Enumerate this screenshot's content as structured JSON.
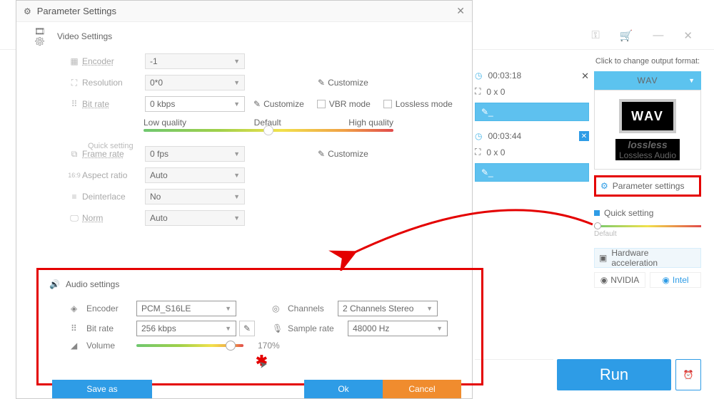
{
  "modal": {
    "title": "Parameter Settings",
    "video": {
      "header": "Video Settings",
      "encoder": {
        "label": "Encoder",
        "value": "-1"
      },
      "resolution": {
        "label": "Resolution",
        "value": "0*0",
        "customize": "Customize"
      },
      "bitrate": {
        "label": "Bit rate",
        "value": "0 kbps",
        "customize": "Customize",
        "vbr": "VBR mode",
        "lossless": "Lossless mode"
      },
      "quickset": {
        "label": "Quick setting",
        "low": "Low quality",
        "default": "Default",
        "high": "High quality"
      },
      "framerate": {
        "label": "Frame rate",
        "value": "0 fps",
        "customize": "Customize"
      },
      "aspect": {
        "label": "Aspect ratio",
        "value": "Auto"
      },
      "deinterlace": {
        "label": "Deinterlace",
        "value": "No"
      },
      "norm": {
        "label": "Norm",
        "value": "Auto"
      }
    },
    "audio": {
      "header": "Audio settings",
      "encoder": {
        "label": "Encoder",
        "value": "PCM_S16LE"
      },
      "channels": {
        "label": "Channels",
        "value": "2 Channels Stereo"
      },
      "bitrate": {
        "label": "Bit rate",
        "value": "256 kbps"
      },
      "samplerate": {
        "label": "Sample rate",
        "value": "48000 Hz"
      },
      "volume": {
        "label": "Volume",
        "value": "170%"
      }
    },
    "buttons": {
      "save": "Save as",
      "ok": "Ok",
      "cancel": "Cancel"
    }
  },
  "files": [
    {
      "duration": "00:03:18",
      "dim": "0 x 0"
    },
    {
      "duration": "00:03:44",
      "dim": "0 x 0"
    }
  ],
  "sidebar": {
    "hint": "Click to change output format:",
    "format": "WAV",
    "wav": "WAV",
    "lossless_big": "lossless",
    "lossless_small": "Lossless Audio",
    "param": "Parameter settings",
    "quick": "Quick setting",
    "default": "Default",
    "hw": "Hardware acceleration",
    "nvidia": "NVIDIA",
    "intel": "Intel"
  },
  "run": "Run"
}
